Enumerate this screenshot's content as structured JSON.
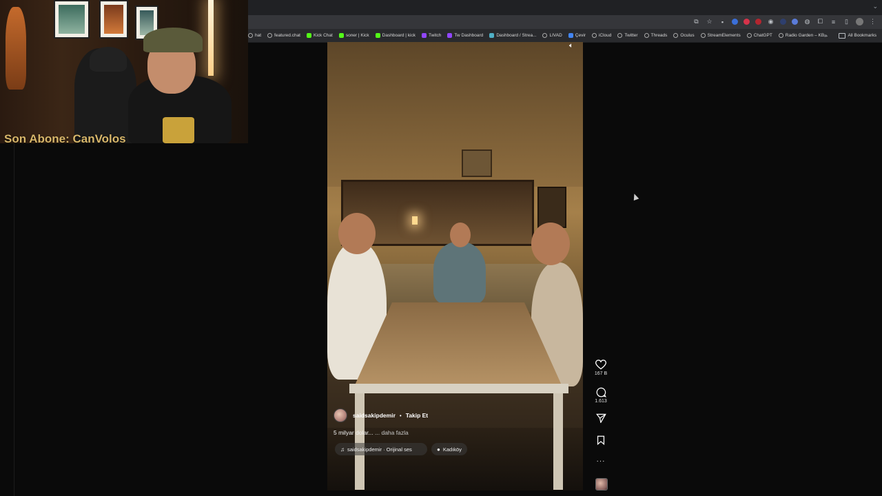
{
  "bookmarks": {
    "items": [
      {
        "label": "hat",
        "fav": "globe",
        "color": ""
      },
      {
        "label": "featured.chat",
        "fav": "globe",
        "color": ""
      },
      {
        "label": "Kick Chat",
        "fav": "square",
        "color": "#53fc18"
      },
      {
        "label": "soner | Kick",
        "fav": "square",
        "color": "#53fc18"
      },
      {
        "label": "Dashboard | kick",
        "fav": "square",
        "color": "#53fc18"
      },
      {
        "label": "Twitch",
        "fav": "square",
        "color": "#9146ff"
      },
      {
        "label": "Tw Dashboard",
        "fav": "square",
        "color": "#9146ff"
      },
      {
        "label": "Dashboard / Strea...",
        "fav": "square",
        "color": "#4fb0c6"
      },
      {
        "label": "LIVAD",
        "fav": "globe",
        "color": ""
      },
      {
        "label": "Çevir",
        "fav": "square",
        "color": "#4285f4"
      },
      {
        "label": "iCloud",
        "fav": "globe",
        "color": ""
      },
      {
        "label": "Twitter",
        "fav": "globe",
        "color": ""
      },
      {
        "label": "Threads",
        "fav": "globe",
        "color": ""
      },
      {
        "label": "Oculus",
        "fav": "globe",
        "color": ""
      },
      {
        "label": "StreamElements",
        "fav": "globe",
        "color": ""
      },
      {
        "label": "ChatGPT",
        "fav": "globe",
        "color": ""
      },
      {
        "label": "Radio Garden – KB...",
        "fav": "globe",
        "color": ""
      }
    ],
    "more": "»",
    "all_bookmarks": "All Bookmarks"
  },
  "webcam": {
    "overlay_text": "Son Abone: CanVolos"
  },
  "post": {
    "username": "saidsakipdemir",
    "separator": "•",
    "follow_label": "Takip Et",
    "caption": "5 milyar dolar...",
    "more_label": "... daha fazla",
    "audio_label": "saidsakipdemir · Orijinal ses",
    "location_label": "Kadıköy"
  },
  "actions": {
    "likes": "167 B",
    "comments": "1.613",
    "more": "···"
  },
  "icons": {
    "mute": "speaker-icon",
    "like": "heart-icon",
    "comment": "comment-icon",
    "share": "share-icon",
    "save": "bookmark-icon",
    "music": "music-note-icon",
    "location": "pin-icon"
  },
  "colors": {
    "overlay_text": "#d7b66a",
    "kick_green": "#53fc18",
    "twitch_purple": "#9146ff"
  }
}
